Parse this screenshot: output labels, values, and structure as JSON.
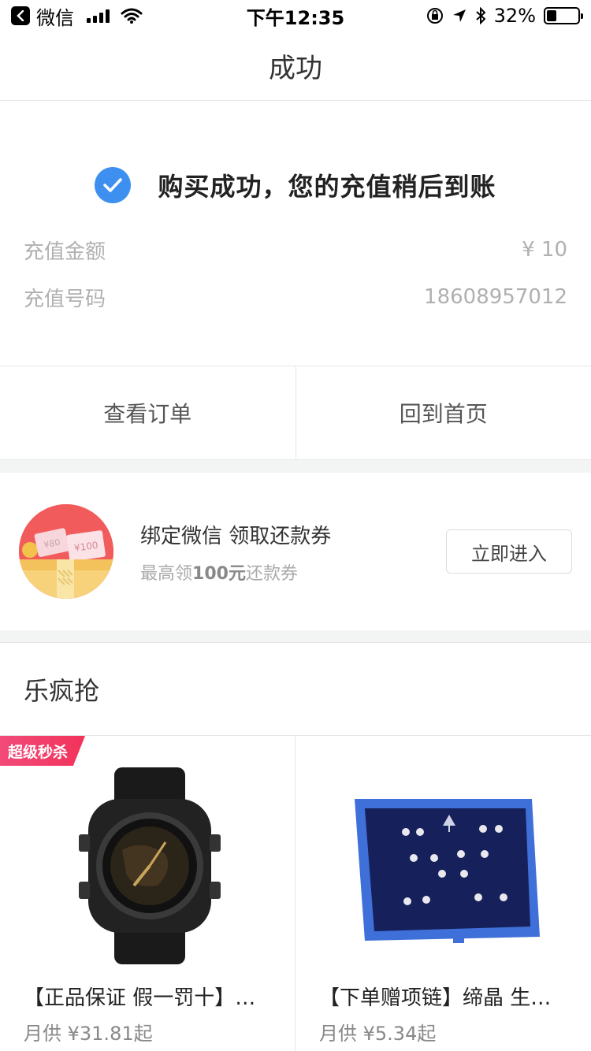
{
  "status_bar": {
    "back_app": "微信",
    "time": "下午12:35",
    "battery": "32%",
    "battery_level": 0.32
  },
  "nav": {
    "title": "成功"
  },
  "result": {
    "message": "购买成功，您的充值稍后到账",
    "amount_label": "充值金额",
    "amount_value": "¥ 10",
    "phone_label": "充值号码",
    "phone_value": "18608957012"
  },
  "actions": {
    "view_order": "查看订单",
    "back_home": "回到首页"
  },
  "promo": {
    "title": "绑定微信 领取还款券",
    "sub_prefix": "最高领",
    "sub_amount": "100元",
    "sub_suffix": "还款券",
    "button": "立即进入",
    "ticket_1": "¥80",
    "ticket_2": "¥100"
  },
  "section": {
    "title": "乐疯抢"
  },
  "products": [
    {
      "tag": "超级秒杀",
      "name": "【正品保证 假一罚十】…",
      "price": "月供 ¥31.81起"
    },
    {
      "name": "【下单赠项链】缔晶 生…",
      "price": "月供 ¥5.34起"
    }
  ],
  "colors": {
    "accent_blue": "#3d8ff0",
    "flash_tag": "#f2335a",
    "promo_bg": "#f15b5b"
  }
}
